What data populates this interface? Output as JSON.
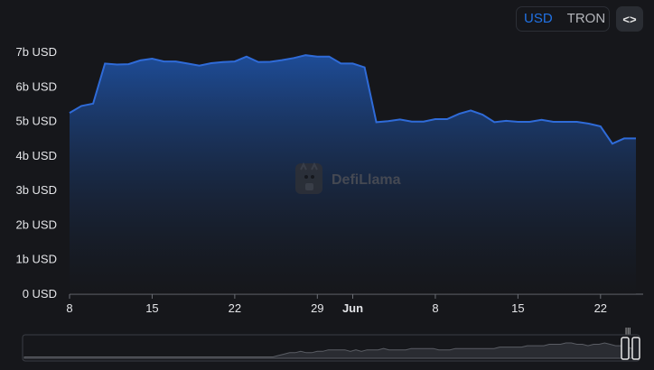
{
  "currency_toggle": {
    "options": [
      "USD",
      "TRON"
    ],
    "selected": "USD"
  },
  "embed_button": {
    "icon": "code-brackets-icon",
    "label": "<>"
  },
  "watermark": {
    "text": "DefiLlama",
    "icon": "llama-logo-icon"
  },
  "colors": {
    "line": "#2f6bd8",
    "area_top": "#1e4f9e",
    "area_bottom": "#16171b",
    "background": "#16171b",
    "accent": "#2172e5"
  },
  "chart_data": {
    "type": "area",
    "x": [
      0,
      1,
      2,
      3,
      4,
      5,
      6,
      7,
      8,
      9,
      10,
      11,
      12,
      13,
      14,
      15,
      16,
      17,
      18,
      19,
      20,
      21,
      22,
      23,
      24,
      25,
      26,
      27,
      28,
      29,
      30,
      31,
      32,
      33,
      34,
      35,
      36,
      37,
      38,
      39,
      40,
      41,
      42,
      43,
      44,
      45,
      46,
      47,
      48
    ],
    "values": [
      5.25,
      5.45,
      5.52,
      6.68,
      6.65,
      6.66,
      6.77,
      6.82,
      6.74,
      6.74,
      6.68,
      6.62,
      6.69,
      6.72,
      6.74,
      6.88,
      6.72,
      6.73,
      6.78,
      6.84,
      6.92,
      6.88,
      6.88,
      6.68,
      6.68,
      6.57,
      4.98,
      5.01,
      5.06,
      5.0,
      5.0,
      5.07,
      5.07,
      5.22,
      5.32,
      5.2,
      4.98,
      5.02,
      4.99,
      4.99,
      5.05,
      4.99,
      4.99,
      4.99,
      4.94,
      4.86,
      4.36,
      4.51,
      4.51
    ],
    "x_tick_labels": [
      "8",
      "15",
      "22",
      "29",
      "Jun",
      "8",
      "15",
      "22"
    ],
    "x_tick_positions": [
      0,
      7,
      14,
      21,
      24,
      31,
      38,
      45
    ],
    "y_tick_labels": [
      "0 USD",
      "1b USD",
      "2b USD",
      "3b USD",
      "4b USD",
      "5b USD",
      "6b USD",
      "7b USD"
    ],
    "y_tick_values": [
      0,
      1,
      2,
      3,
      4,
      5,
      6,
      7
    ],
    "ylim": [
      0,
      7.5
    ],
    "xlim": [
      0,
      48
    ],
    "unit": "b USD",
    "grid": false,
    "legend": "none"
  },
  "brush": {
    "handle_left_icon": "drag-handle-icon",
    "handle_right_icon": "drag-handle-icon",
    "overview": [
      1,
      1,
      1,
      1,
      1,
      1,
      1,
      1,
      1,
      1,
      1,
      1,
      1,
      1,
      1,
      1,
      1,
      1,
      1,
      1,
      1,
      1,
      1,
      1,
      1,
      1,
      1,
      1,
      1,
      1,
      1,
      1,
      1,
      1,
      1,
      1,
      1,
      1,
      1,
      1,
      1,
      1,
      1,
      1,
      1,
      1,
      2,
      3,
      4,
      4,
      5,
      4,
      4,
      5,
      5,
      6,
      6,
      6,
      6,
      5,
      6,
      5,
      6,
      6,
      6,
      7,
      6,
      6,
      6,
      6,
      7,
      7,
      7,
      7,
      7,
      6,
      6,
      6,
      7,
      7,
      7,
      7,
      7,
      7,
      7,
      7,
      8,
      8,
      8,
      8,
      8,
      9,
      9,
      9,
      9,
      10,
      10,
      10,
      11,
      11,
      10,
      10,
      9,
      10,
      10,
      11,
      10,
      9,
      9,
      8,
      7,
      8
    ]
  }
}
